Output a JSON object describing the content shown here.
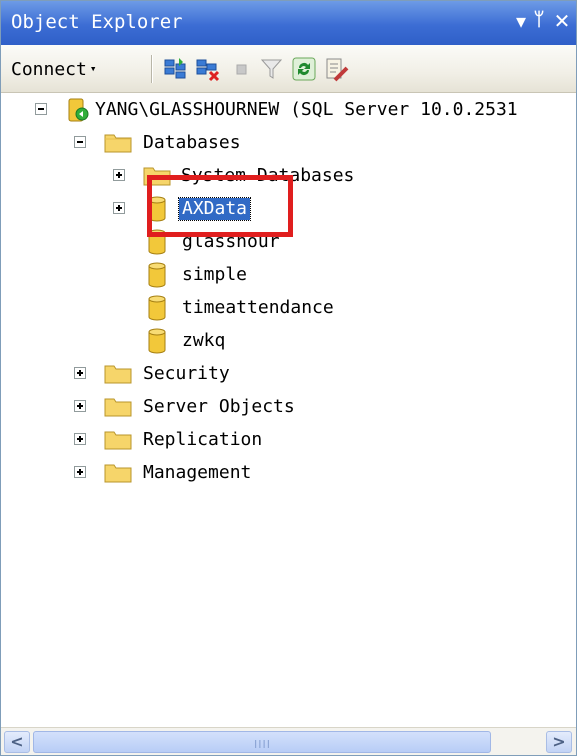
{
  "panel": {
    "title": "Object Explorer",
    "pin_glyph": "▾ ⊥",
    "close_glyph": "✕"
  },
  "toolbar": {
    "connect_label": "Connect",
    "connect_arrow": "▾",
    "icons": [
      "register-servers-icon",
      "disconnect-icon",
      "stop-icon",
      "filter-icon",
      "refresh-icon",
      "summary-icon"
    ]
  },
  "tree": {
    "server": "YANG\\GLASSHOURNEW (SQL Server 10.0.2531",
    "databases_folder": "Databases",
    "system_databases": "System Databases",
    "databases": [
      "AXData",
      "glasshour",
      "simple",
      "timeattendance",
      "zwkq"
    ],
    "selected_database": "AXData",
    "folders": [
      "Security",
      "Server Objects",
      "Replication",
      "Management"
    ]
  },
  "scrollbar": {
    "left_arrow": "<",
    "right_arrow": ">",
    "grip": "IIII"
  },
  "colors": {
    "title_bar": "#3c6dd4",
    "selection": "#316ac5",
    "highlight_box": "#e01e1e",
    "folder": "#f6d56a",
    "database": "#f2c83a"
  }
}
